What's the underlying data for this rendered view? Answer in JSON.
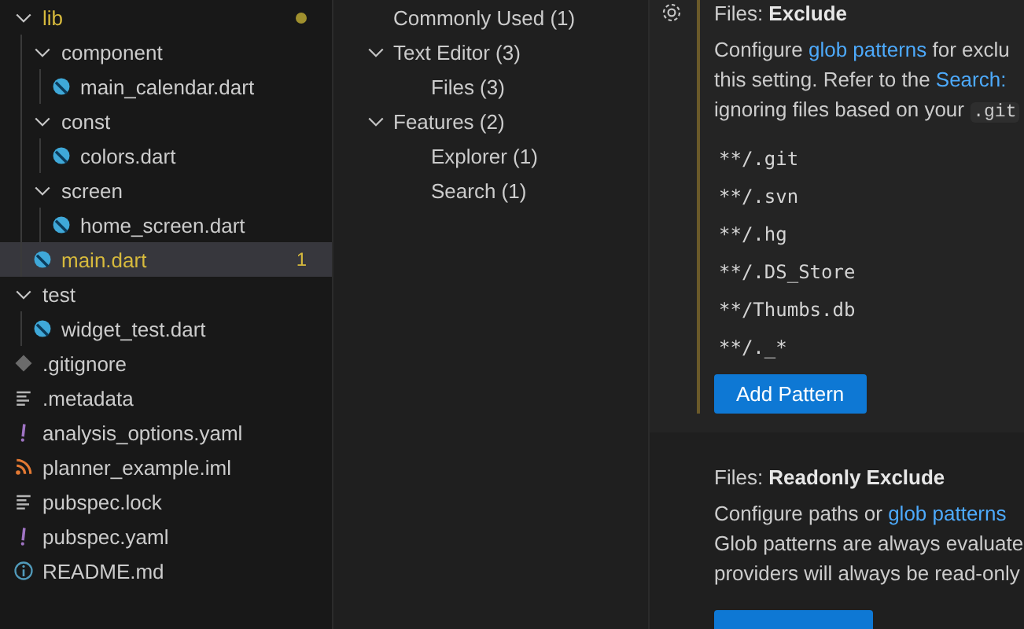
{
  "explorer": {
    "items": [
      {
        "label": "lib",
        "kind": "folder",
        "expanded": true,
        "modified": true,
        "selected": false,
        "children": [
          {
            "label": "component",
            "kind": "folder",
            "expanded": true,
            "modified": false,
            "selected": false,
            "children": [
              {
                "label": "main_calendar.dart",
                "kind": "dart",
                "modified": false,
                "selected": false
              }
            ]
          },
          {
            "label": "const",
            "kind": "folder",
            "expanded": true,
            "modified": false,
            "selected": false,
            "children": [
              {
                "label": "colors.dart",
                "kind": "dart",
                "modified": false,
                "selected": false
              }
            ]
          },
          {
            "label": "screen",
            "kind": "folder",
            "expanded": true,
            "modified": false,
            "selected": false,
            "children": [
              {
                "label": "home_screen.dart",
                "kind": "dart",
                "modified": false,
                "selected": false
              }
            ]
          },
          {
            "label": "main.dart",
            "kind": "dart",
            "modified": true,
            "selected": true,
            "badge": "1"
          }
        ]
      },
      {
        "label": "test",
        "kind": "folder",
        "expanded": true,
        "modified": false,
        "selected": false,
        "children": [
          {
            "label": "widget_test.dart",
            "kind": "dart",
            "modified": false,
            "selected": false
          }
        ]
      },
      {
        "label": ".gitignore",
        "kind": "git",
        "modified": false,
        "selected": false
      },
      {
        "label": ".metadata",
        "kind": "lines",
        "modified": false,
        "selected": false
      },
      {
        "label": "analysis_options.yaml",
        "kind": "yaml",
        "modified": false,
        "selected": false
      },
      {
        "label": "planner_example.iml",
        "kind": "rss",
        "modified": false,
        "selected": false
      },
      {
        "label": "pubspec.lock",
        "kind": "lines",
        "modified": false,
        "selected": false
      },
      {
        "label": "pubspec.yaml",
        "kind": "yaml",
        "modified": false,
        "selected": false
      },
      {
        "label": "README.md",
        "kind": "info",
        "modified": false,
        "selected": false
      }
    ]
  },
  "toc": {
    "items": [
      {
        "label": "Commonly Used (1)"
      },
      {
        "label": "Text Editor (3)",
        "expanded": true,
        "children": [
          {
            "label": "Files (3)"
          }
        ]
      },
      {
        "label": "Features (2)",
        "expanded": true,
        "children": [
          {
            "label": "Explorer (1)"
          },
          {
            "label": "Search (1)"
          }
        ]
      }
    ]
  },
  "settings": [
    {
      "category": "Files: ",
      "title": "Exclude",
      "modified": true,
      "description": [
        [
          {
            "kind": "text",
            "text": "Configure "
          },
          {
            "kind": "link",
            "text": "glob patterns"
          },
          {
            "kind": "text",
            "text": " for exclu"
          }
        ],
        [
          {
            "kind": "text",
            "text": "this setting. Refer to the "
          },
          {
            "kind": "link",
            "text": "Search:"
          }
        ],
        [
          {
            "kind": "text",
            "text": "ignoring files based on your "
          },
          {
            "kind": "code",
            "text": ".git"
          }
        ]
      ],
      "patterns": [
        "**/.git",
        "**/.svn",
        "**/.hg",
        "**/.DS_Store",
        "**/Thumbs.db",
        "**/._*"
      ],
      "button": "Add Pattern"
    },
    {
      "category": "Files: ",
      "title": "Readonly Exclude",
      "modified": false,
      "description": [
        [
          {
            "kind": "text",
            "text": "Configure paths or "
          },
          {
            "kind": "link",
            "text": "glob patterns"
          }
        ],
        [
          {
            "kind": "text",
            "text": "Glob patterns are always evaluate"
          }
        ],
        [
          {
            "kind": "text",
            "text": "providers will always be read-only"
          }
        ]
      ]
    }
  ]
}
